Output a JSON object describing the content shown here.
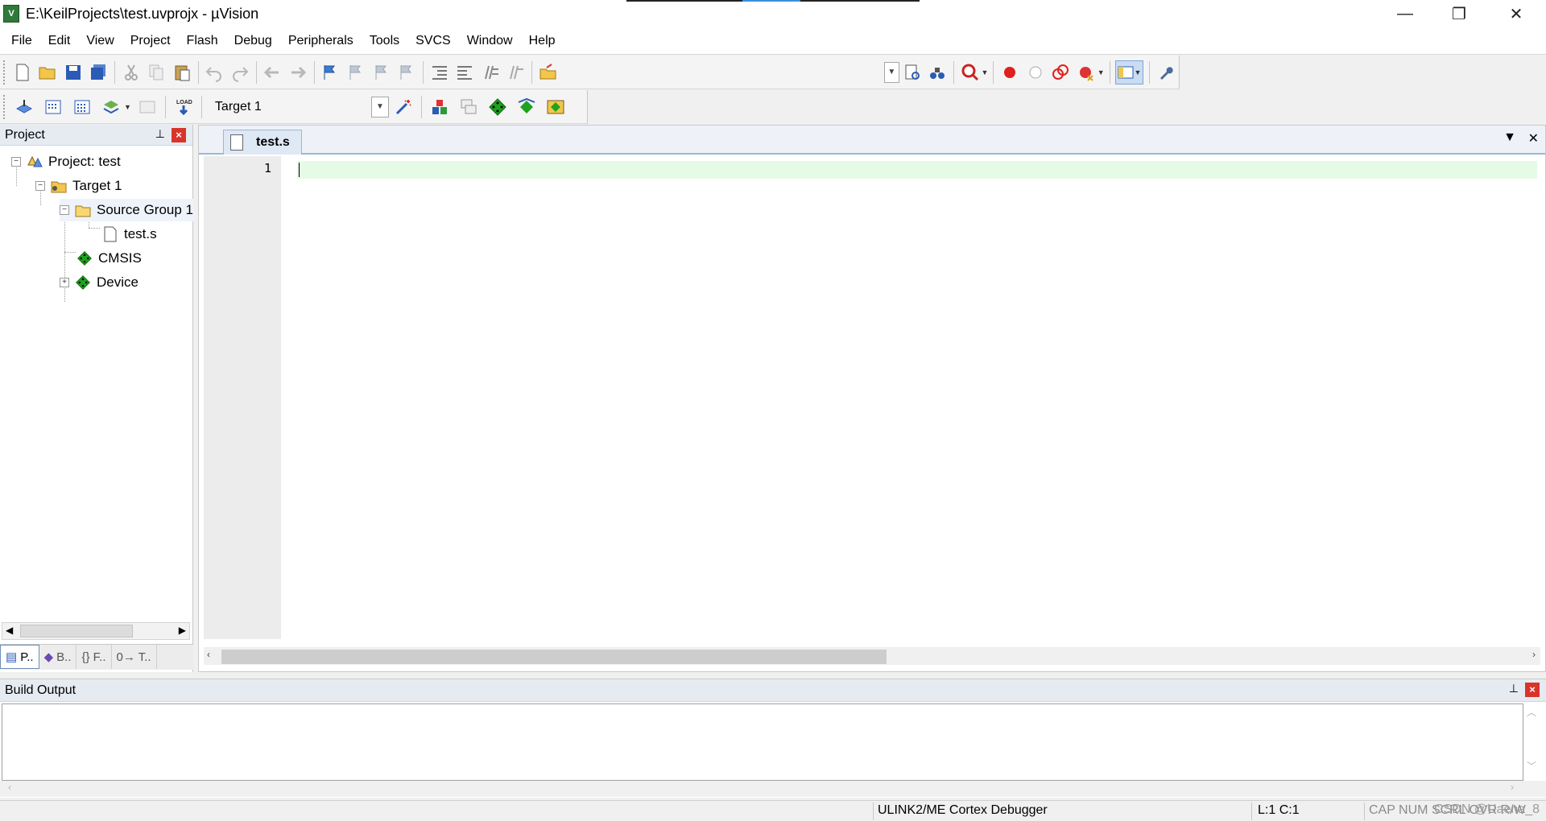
{
  "window": {
    "title": "E:\\KeilProjects\\test.uvprojx - µVision",
    "app_icon_letter": "V",
    "minimize_glyph": "—",
    "restore_glyph": "❐",
    "close_glyph": "✕"
  },
  "menu": [
    "File",
    "Edit",
    "View",
    "Project",
    "Flash",
    "Debug",
    "Peripherals",
    "Tools",
    "SVCS",
    "Window",
    "Help"
  ],
  "toolbar2": {
    "target": "Target 1",
    "load_label": "LOAD"
  },
  "project_pane": {
    "title": "Project",
    "pin_glyph": "📌",
    "close_glyph": "×",
    "tree": {
      "root": "Project: test",
      "target": "Target 1",
      "group": "Source Group 1",
      "file": "test.s",
      "cmsis": "CMSIS",
      "device": "Device"
    },
    "tabs": [
      "P..",
      "B..",
      "{} F..",
      "0→ T.."
    ]
  },
  "editor": {
    "tab_name": "test.s",
    "line_numbers": [
      "1"
    ],
    "content": ""
  },
  "build_output": {
    "title": "Build Output",
    "content": ""
  },
  "statusbar": {
    "debugger": "ULINK2/ME Cortex Debugger",
    "position": "L:1 C:1",
    "flags": "CAP  NUM  SCRL  OVR  R/W",
    "watermark": "CSDN @Uaena_8"
  },
  "colors": {
    "current_line": "#e6fbe6",
    "pane_header": "#e6ebf2",
    "close_red": "#d9342b"
  }
}
